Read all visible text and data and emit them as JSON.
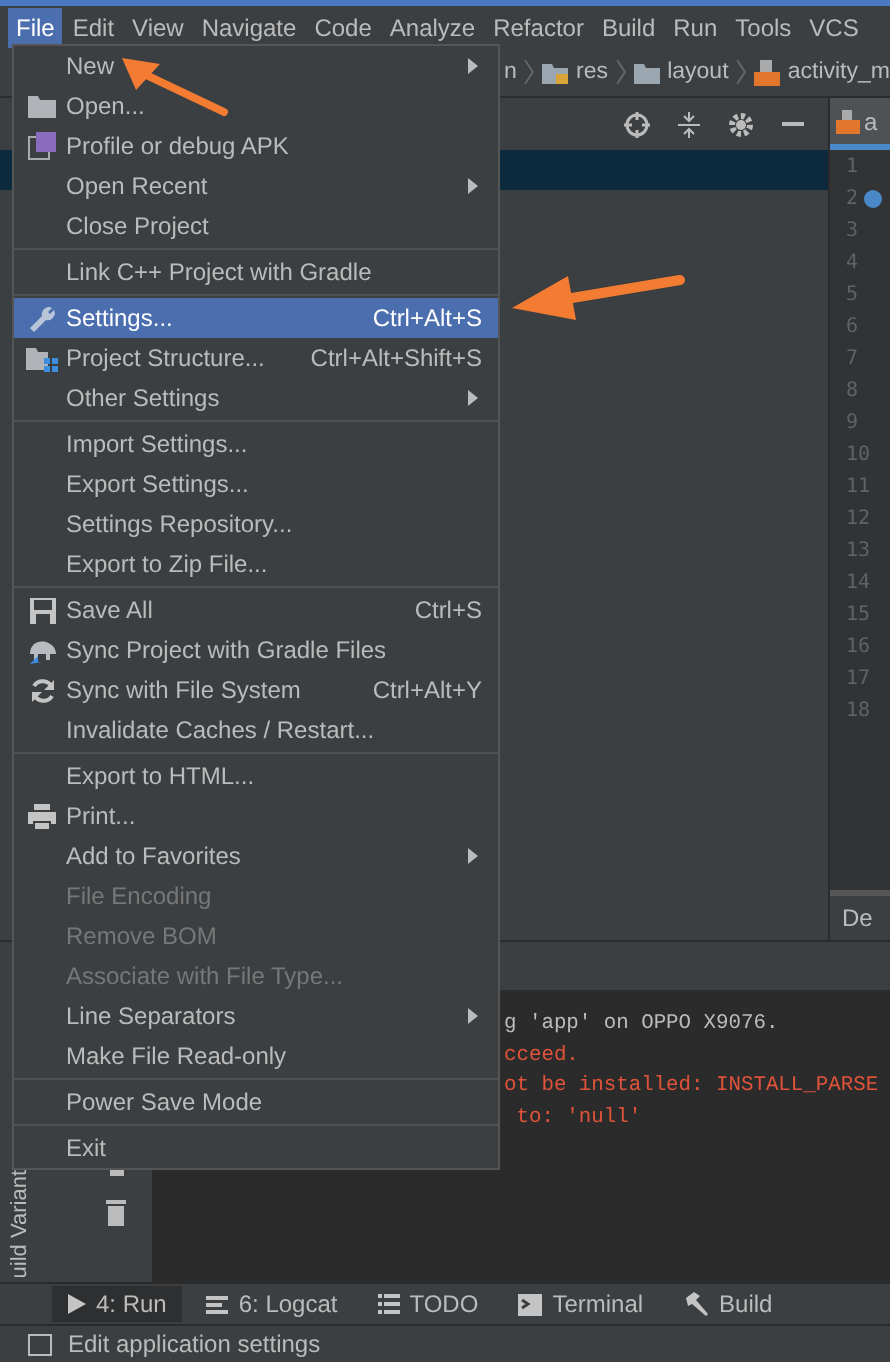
{
  "menubar": [
    {
      "label": "File",
      "selected": true
    },
    {
      "label": "Edit",
      "selected": false
    },
    {
      "label": "View",
      "selected": false
    },
    {
      "label": "Navigate",
      "selected": false
    },
    {
      "label": "Code",
      "selected": false
    },
    {
      "label": "Analyze",
      "selected": false
    },
    {
      "label": "Refactor",
      "selected": false
    },
    {
      "label": "Build",
      "selected": false
    },
    {
      "label": "Run",
      "selected": false
    },
    {
      "label": "Tools",
      "selected": false
    },
    {
      "label": "VCS",
      "selected": false
    }
  ],
  "breadcrumb": [
    "n",
    "res",
    "layout",
    "activity_m"
  ],
  "editor_tab": "a",
  "line_numbers": [
    "1",
    "2",
    "3",
    "4",
    "5",
    "6",
    "7",
    "8",
    "9",
    "10",
    "11",
    "12",
    "13",
    "14",
    "15",
    "16",
    "17",
    "18"
  ],
  "design_tab": "De",
  "run_output": [
    {
      "text": "g 'app' on OPPO X9076.",
      "kind": "info"
    },
    {
      "text": "cceed.",
      "kind": "error"
    },
    {
      "text": "ot be installed: INSTALL_PARSE",
      "kind": "error"
    },
    {
      "text": " to: 'null'",
      "kind": "error"
    }
  ],
  "side_stripe": "uild Variant",
  "file_menu": {
    "sections": [
      [
        {
          "label": "New",
          "kind": "plain",
          "submenu": true,
          "selected": false,
          "disabled": false
        },
        {
          "label": "Open...",
          "kind": "folder",
          "submenu": false,
          "selected": false,
          "disabled": false
        },
        {
          "label": "Profile or debug APK",
          "kind": "apk",
          "submenu": false,
          "selected": false,
          "disabled": false
        },
        {
          "label": "Open Recent",
          "kind": "plain",
          "submenu": true,
          "selected": false,
          "disabled": false
        },
        {
          "label": "Close Project",
          "kind": "plain",
          "submenu": false,
          "selected": false,
          "disabled": false
        }
      ],
      [
        {
          "label": "Link C++ Project with Gradle",
          "kind": "plain",
          "submenu": false,
          "selected": false,
          "disabled": false
        }
      ],
      [
        {
          "label": "Settings...",
          "kind": "wrench",
          "shortcut": "Ctrl+Alt+S",
          "submenu": false,
          "selected": true,
          "disabled": false
        },
        {
          "label": "Project Structure...",
          "kind": "structure",
          "shortcut": "Ctrl+Alt+Shift+S",
          "submenu": false,
          "selected": false,
          "disabled": false
        },
        {
          "label": "Other Settings",
          "kind": "plain",
          "submenu": true,
          "selected": false,
          "disabled": false
        }
      ],
      [
        {
          "label": "Import Settings...",
          "kind": "plain",
          "submenu": false,
          "selected": false,
          "disabled": false
        },
        {
          "label": "Export Settings...",
          "kind": "plain",
          "submenu": false,
          "selected": false,
          "disabled": false
        },
        {
          "label": "Settings Repository...",
          "kind": "plain",
          "submenu": false,
          "selected": false,
          "disabled": false
        },
        {
          "label": "Export to Zip File...",
          "kind": "plain",
          "submenu": false,
          "selected": false,
          "disabled": false
        }
      ],
      [
        {
          "label": "Save All",
          "kind": "save",
          "shortcut": "Ctrl+S",
          "submenu": false,
          "selected": false,
          "disabled": false
        },
        {
          "label": "Sync Project with Gradle Files",
          "kind": "gradle",
          "submenu": false,
          "selected": false,
          "disabled": false
        },
        {
          "label": "Sync with File System",
          "kind": "sync",
          "shortcut": "Ctrl+Alt+Y",
          "submenu": false,
          "selected": false,
          "disabled": false
        },
        {
          "label": "Invalidate Caches / Restart...",
          "kind": "plain",
          "submenu": false,
          "selected": false,
          "disabled": false
        }
      ],
      [
        {
          "label": "Export to HTML...",
          "kind": "plain",
          "submenu": false,
          "selected": false,
          "disabled": false
        },
        {
          "label": "Print...",
          "kind": "printer",
          "submenu": false,
          "selected": false,
          "disabled": false
        },
        {
          "label": "Add to Favorites",
          "kind": "plain",
          "submenu": true,
          "selected": false,
          "disabled": false
        },
        {
          "label": "File Encoding",
          "kind": "plain",
          "submenu": false,
          "selected": false,
          "disabled": true
        },
        {
          "label": "Remove BOM",
          "kind": "plain",
          "submenu": false,
          "selected": false,
          "disabled": true
        },
        {
          "label": "Associate with File Type...",
          "kind": "plain",
          "submenu": false,
          "selected": false,
          "disabled": true
        },
        {
          "label": "Line Separators",
          "kind": "plain",
          "submenu": true,
          "selected": false,
          "disabled": false
        },
        {
          "label": "Make File Read-only",
          "kind": "plain",
          "submenu": false,
          "selected": false,
          "disabled": false
        }
      ],
      [
        {
          "label": "Power Save Mode",
          "kind": "plain",
          "submenu": false,
          "selected": false,
          "disabled": false
        }
      ],
      [
        {
          "label": "Exit",
          "kind": "plain",
          "submenu": false,
          "selected": false,
          "disabled": false
        }
      ]
    ]
  },
  "tool_tabs": [
    {
      "label": "4: Run",
      "kind": "run",
      "selected": true
    },
    {
      "label": "6: Logcat",
      "kind": "logcat",
      "selected": false
    },
    {
      "label": "TODO",
      "kind": "todo",
      "selected": false
    },
    {
      "label": "Terminal",
      "kind": "terminal",
      "selected": false
    },
    {
      "label": "Build",
      "kind": "build",
      "selected": false
    }
  ],
  "status_bar": "Edit application settings"
}
